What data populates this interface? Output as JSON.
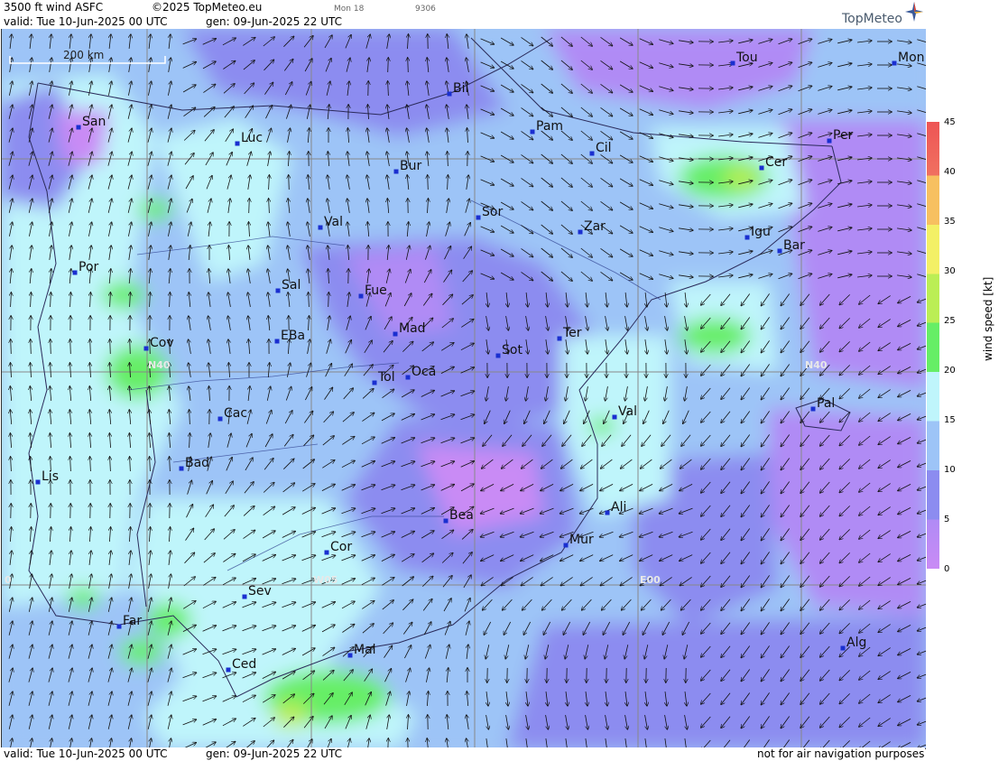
{
  "header": {
    "product": "3500 ft wind ASFC",
    "copyright": "©2025 TopMeteo.eu",
    "valid": "valid:  Tue  10-Jun-2025  00 UTC",
    "gen": "gen:  09-Jun-2025 22 UTC",
    "tiny1": "Mon 18",
    "tiny2": "9306",
    "logo": "TopMeteo"
  },
  "footer": {
    "valid": "valid:  Tue  10-Jun-2025  00 UTC",
    "gen": "gen:  09-Jun-2025 22 UTC",
    "note": "not for air navigation purposes"
  },
  "scale": {
    "label": "200 km"
  },
  "legend": {
    "unit": "wind speed [kt]",
    "ticks": [
      "45",
      "40",
      "35",
      "30",
      "25",
      "20",
      "15",
      "10",
      "5",
      "0"
    ]
  },
  "grid_labels": {
    "n40_left": "N40",
    "n40_right": "N40",
    "w05": "W05",
    "e00": "E00",
    "left0": "0"
  },
  "cities": [
    {
      "name": "San"
    },
    {
      "name": "Luc"
    },
    {
      "name": "Bil"
    },
    {
      "name": "Pam"
    },
    {
      "name": "Cil"
    },
    {
      "name": "Tou"
    },
    {
      "name": "Mon"
    },
    {
      "name": "Per"
    },
    {
      "name": "Cer"
    },
    {
      "name": "Bur"
    },
    {
      "name": "Sor"
    },
    {
      "name": "Zar"
    },
    {
      "name": "Igu"
    },
    {
      "name": "Bar"
    },
    {
      "name": "Val"
    },
    {
      "name": "Por"
    },
    {
      "name": "Sal"
    },
    {
      "name": "Fue"
    },
    {
      "name": "Mad"
    },
    {
      "name": "Cov"
    },
    {
      "name": "EBa"
    },
    {
      "name": "Sot"
    },
    {
      "name": "Ter"
    },
    {
      "name": "Tol"
    },
    {
      "name": "Oca"
    },
    {
      "name": "Cac"
    },
    {
      "name": "Val"
    },
    {
      "name": "Pal"
    },
    {
      "name": "Bad"
    },
    {
      "name": "Lis"
    },
    {
      "name": "Bea"
    },
    {
      "name": "Ali"
    },
    {
      "name": "Mur"
    },
    {
      "name": "Cor"
    },
    {
      "name": "Sev"
    },
    {
      "name": "Far"
    },
    {
      "name": "Mal"
    },
    {
      "name": "Ced"
    },
    {
      "name": "Alg"
    }
  ],
  "colors": {
    "calm": "#c98bf5",
    "light": "#8c8cf0",
    "mid": "#9dc4f7",
    "fresh": "#bff5fb",
    "strong": "#66ee66",
    "city": "#1a2fd0"
  }
}
